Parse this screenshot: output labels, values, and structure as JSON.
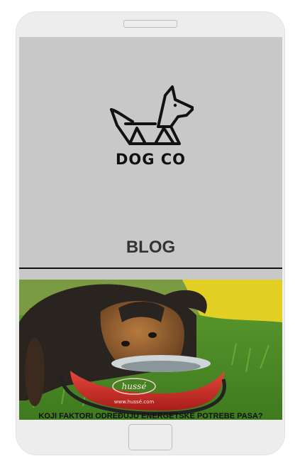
{
  "brand": {
    "name": "DOG CO",
    "logo_icon": "dog-logo-icon"
  },
  "page": {
    "title": "BLOG"
  },
  "post": {
    "title": "KOJI FAKTORI ODREĐUJU ENERGETSKE POTREBE PASA?",
    "image_description": "puppy-eating-from-bowl",
    "bowl_text": "hussé",
    "bowl_url": "www.hussé.com"
  },
  "colors": {
    "screen_background": "#c8c8c8",
    "device_frame": "#ededed",
    "divider": "#111111"
  }
}
